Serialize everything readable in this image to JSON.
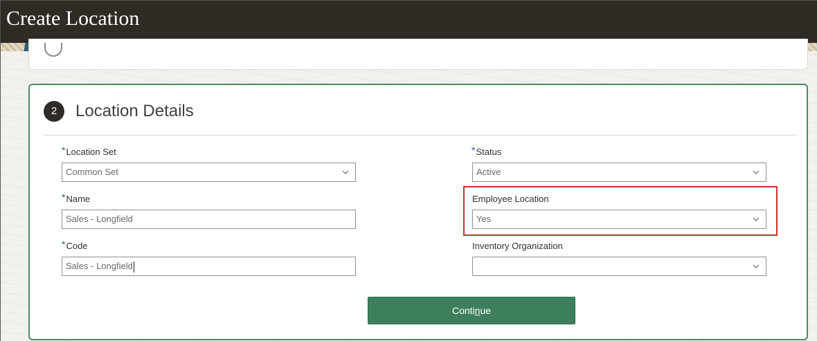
{
  "window": {
    "title": "Create Location"
  },
  "section": {
    "step_number": "2",
    "title": "Location Details"
  },
  "fields": {
    "location_set": {
      "label": "Location Set",
      "required": "*",
      "value": "Common Set"
    },
    "name": {
      "label": "Name",
      "required": "*",
      "value": "Sales - Longfield"
    },
    "code": {
      "label": "Code",
      "required": "*",
      "value": "Sales - Longfield"
    },
    "status": {
      "label": "Status",
      "required": "*",
      "value": "Active"
    },
    "employee_location": {
      "label": "Employee Location",
      "value": "Yes"
    },
    "inventory_organization": {
      "label": "Inventory Organization",
      "value": ""
    }
  },
  "actions": {
    "continue_label_before": "Conti",
    "continue_label_accesskey": "n",
    "continue_label_after": "ue"
  },
  "icons": {
    "dropdown": "chevron-down-icon",
    "step": "step-number-badge"
  },
  "colors": {
    "header_bg": "#302a25",
    "card_border": "#4a8a63",
    "button_bg": "#3d7f5c",
    "highlight": "#d12c2c",
    "required_marker": "#2b5c9e"
  }
}
